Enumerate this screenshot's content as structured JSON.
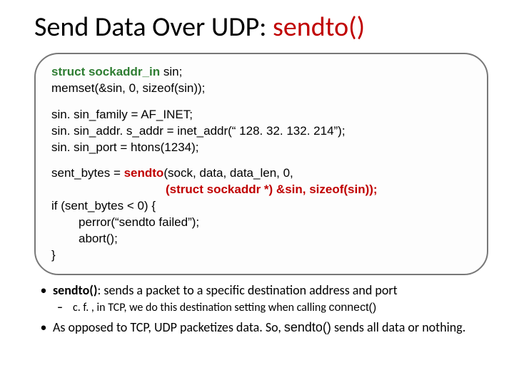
{
  "title": {
    "prefix": "Send Data Over UDP: ",
    "fn": "sendto()"
  },
  "code": {
    "b1": {
      "l1a": "struct sockaddr_in",
      "l1b": " sin;",
      "l2": "memset(&sin, 0, sizeof(sin));"
    },
    "b2": {
      "l1": "sin. sin_family = AF_INET;",
      "l2": "sin. sin_addr. s_addr = inet_addr(“ 128. 32. 132. 214”);",
      "l3": "sin. sin_port = htons(1234);"
    },
    "b3": {
      "l1a": "sent_bytes = ",
      "l1b": "sendto",
      "l1c": "(sock, data, data_len, 0,",
      "l2": "(struct sockaddr *) &sin, sizeof(sin));",
      "l3": "if (sent_bytes < 0) {",
      "l4": "perror(“sendto failed”);",
      "l5": "abort();",
      "l6": "}"
    }
  },
  "bullets": {
    "p1a": "sendto()",
    "p1b": ": sends a packet to a specific destination address and port",
    "p1sub_a": "c. f. , in TCP, we do this destination setting when calling ",
    "p1sub_b": "connect()",
    "p2a": "As opposed to TCP, UDP packetizes data. So, ",
    "p2b": "sendto()",
    "p2c": " sends all data or nothing."
  }
}
